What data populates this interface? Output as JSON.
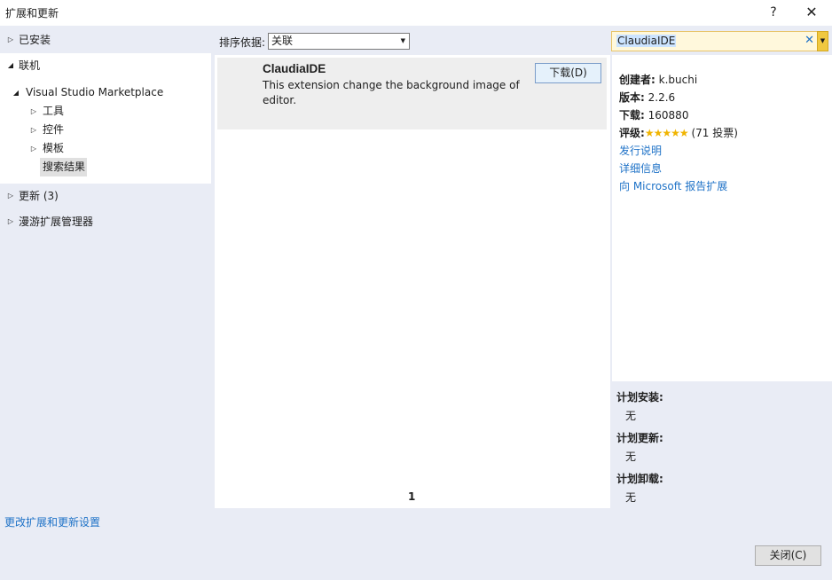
{
  "window": {
    "title": "扩展和更新",
    "help_label": "?",
    "close_glyph": "✕"
  },
  "sidebar": {
    "installed": "已安装",
    "online": "联机",
    "marketplace": "Visual Studio Marketplace",
    "tools": "工具",
    "controls": "控件",
    "templates": "模板",
    "search_results": "搜索结果",
    "updates": "更新 (3)",
    "roaming": "漫游扩展管理器"
  },
  "sort": {
    "label": "排序依据:",
    "value": "关联"
  },
  "search": {
    "value": "ClaudiaIDE",
    "clear_glyph": "✕"
  },
  "results": [
    {
      "name": "ClaudiaIDE",
      "description": "This extension change the background image of editor.",
      "download_label": "下载(D)"
    }
  ],
  "pagination": {
    "current": "1"
  },
  "details": {
    "author_label": "创建者:",
    "author": "k.buchi",
    "version_label": "版本:",
    "version": "2.2.6",
    "downloads_label": "下载:",
    "downloads": "160880",
    "rating_label": "评级:",
    "rating_stars": "★★★★★",
    "rating_votes": "(71 投票)",
    "release_notes": "发行说明",
    "more_info": "详细信息",
    "report": "向 Microsoft 报告扩展"
  },
  "plan": {
    "install_label": "计划安装:",
    "install_value": "无",
    "update_label": "计划更新:",
    "update_value": "无",
    "uninstall_label": "计划卸载:",
    "uninstall_value": "无"
  },
  "footer": {
    "settings_link": "更改扩展和更新设置",
    "close_label": "关闭(C)"
  },
  "colors": {
    "panel": "#e9ecf5",
    "link": "#1e72c7",
    "star": "#f0b400"
  }
}
